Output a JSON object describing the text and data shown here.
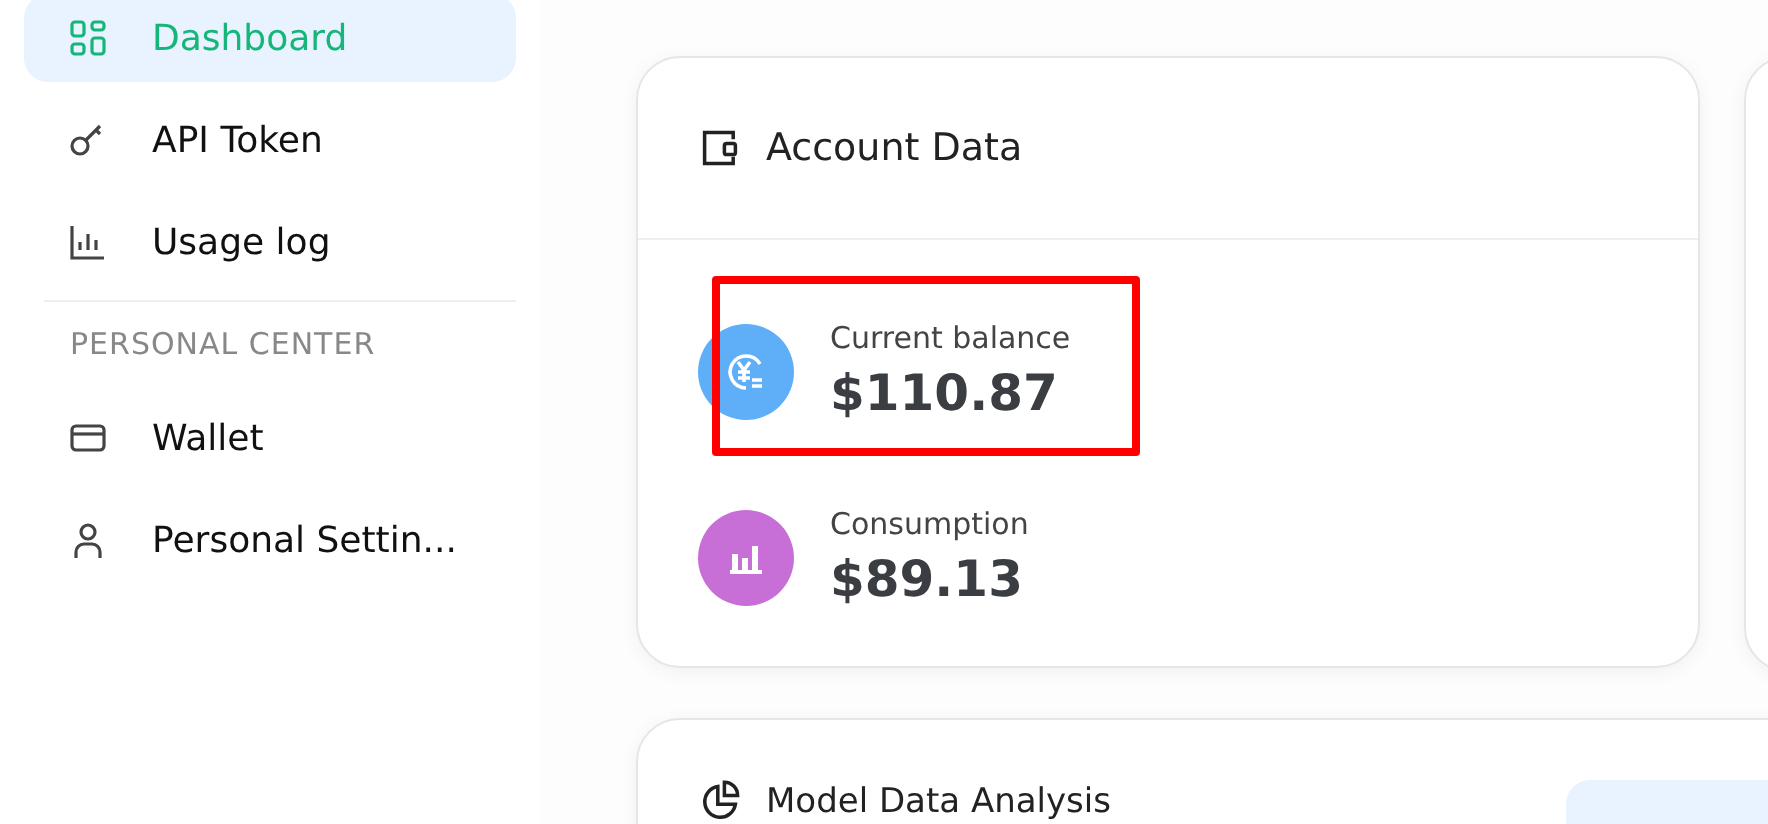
{
  "sidebar": {
    "items": [
      {
        "label": "Dashboard",
        "kind": "grid",
        "selected": true
      },
      {
        "label": "API Token",
        "kind": "key",
        "selected": false
      },
      {
        "label": "Usage log",
        "kind": "chart",
        "selected": false
      }
    ],
    "section": {
      "title": "PERSONAL CENTER",
      "items": [
        {
          "label": "Wallet",
          "kind": "card",
          "selected": false
        },
        {
          "label": "Personal Settin...",
          "kind": "user",
          "selected": false
        }
      ]
    }
  },
  "account_card": {
    "title": "Account Data",
    "stats": [
      {
        "label": "Current balance",
        "value": "$110.87",
        "kind": "yen",
        "color": "#5eaef8",
        "highlighted": true
      },
      {
        "label": "Consumption",
        "value": "$89.13",
        "kind": "bars",
        "color": "#c76fd6",
        "highlighted": false
      }
    ]
  },
  "analysis_card": {
    "title": "Model Data Analysis"
  }
}
